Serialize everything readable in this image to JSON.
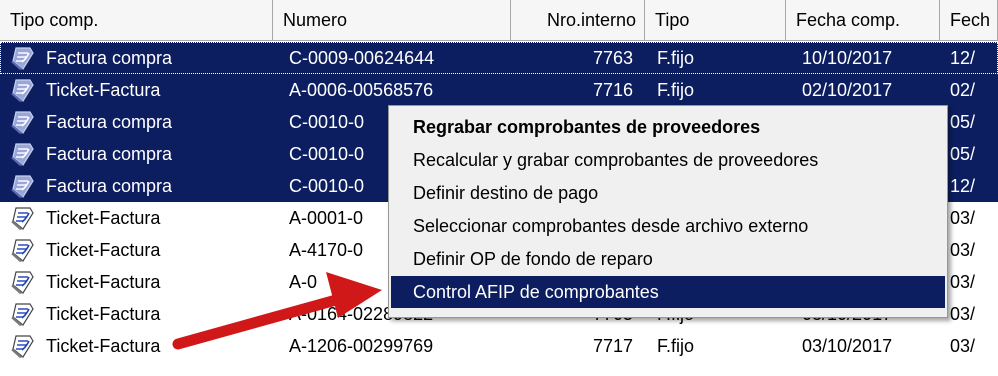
{
  "grid": {
    "columns": [
      {
        "label": "Tipo comp.",
        "align": "left"
      },
      {
        "label": "Numero",
        "align": "left"
      },
      {
        "label": "Nro.interno",
        "align": "right"
      },
      {
        "label": "Tipo",
        "align": "left"
      },
      {
        "label": "Fecha comp.",
        "align": "left"
      },
      {
        "label": "Fech",
        "align": "left"
      }
    ],
    "rows": [
      {
        "tipo_comp": "Factura compra",
        "numero": "C-0009-00624644",
        "nro_interno": "7763",
        "tipo": "F.fijo",
        "fecha_comp": "10/10/2017",
        "fech": "12/",
        "selected": true,
        "focused": true,
        "icon": "selected-document-icon"
      },
      {
        "tipo_comp": "Ticket-Factura",
        "numero": "A-0006-00568576",
        "nro_interno": "7716",
        "tipo": "F.fijo",
        "fecha_comp": "02/10/2017",
        "fech": "02/",
        "selected": true,
        "icon": "selected-document-icon"
      },
      {
        "tipo_comp": "Factura compra",
        "numero": "C-0010-0",
        "nro_interno": "",
        "tipo": "",
        "fecha_comp": "",
        "fech": "05/",
        "selected": true,
        "icon": "selected-document-icon"
      },
      {
        "tipo_comp": "Factura compra",
        "numero": "C-0010-0",
        "nro_interno": "",
        "tipo": "",
        "fecha_comp": "",
        "fech": "05/",
        "selected": true,
        "icon": "selected-document-icon"
      },
      {
        "tipo_comp": "Factura compra",
        "numero": "C-0010-0",
        "nro_interno": "",
        "tipo": "",
        "fecha_comp": "",
        "fech": "12/",
        "selected": true,
        "icon": "selected-document-icon"
      },
      {
        "tipo_comp": "Ticket-Factura",
        "numero": "A-0001-0",
        "nro_interno": "",
        "tipo": "",
        "fecha_comp": "",
        "fech": "03/",
        "selected": false,
        "icon": "document-icon"
      },
      {
        "tipo_comp": "Ticket-Factura",
        "numero": "A-4170-0",
        "nro_interno": "",
        "tipo": "",
        "fecha_comp": "",
        "fech": "03/",
        "selected": false,
        "icon": "document-icon"
      },
      {
        "tipo_comp": "Ticket-Factura",
        "numero": "A-0",
        "nro_interno": "",
        "tipo": "",
        "fecha_comp": "",
        "fech": "03/",
        "selected": false,
        "icon": "document-icon"
      },
      {
        "tipo_comp": "Ticket-Factura",
        "numero": "A-0164-02289822",
        "nro_interno": "7705",
        "tipo": "F.fijo",
        "fecha_comp": "03/10/2017",
        "fech": "03/",
        "selected": false,
        "icon": "document-icon"
      },
      {
        "tipo_comp": "Ticket-Factura",
        "numero": "A-1206-00299769",
        "nro_interno": "7717",
        "tipo": "F.fijo",
        "fecha_comp": "03/10/2017",
        "fech": "03/",
        "selected": false,
        "icon": "document-icon"
      }
    ]
  },
  "context_menu": {
    "items": [
      {
        "label": "Regrabar comprobantes de proveedores",
        "bold": true,
        "highlighted": false
      },
      {
        "label": "Recalcular y grabar comprobantes de proveedores",
        "bold": false,
        "highlighted": false
      },
      {
        "label": "Definir destino de pago",
        "bold": false,
        "highlighted": false
      },
      {
        "label": "Seleccionar comprobantes desde archivo externo",
        "bold": false,
        "highlighted": false
      },
      {
        "label": "Definir OP de fondo de reparo",
        "bold": false,
        "highlighted": false
      },
      {
        "label": "Control AFIP de comprobantes",
        "bold": false,
        "highlighted": true
      }
    ]
  },
  "annotation": {
    "icon": "red-arrow-icon",
    "color": "#d01818"
  },
  "colors": {
    "selection": "#0d1e60",
    "header_bg": "#f6f6f6",
    "menu_bg": "#f0f0f0"
  }
}
